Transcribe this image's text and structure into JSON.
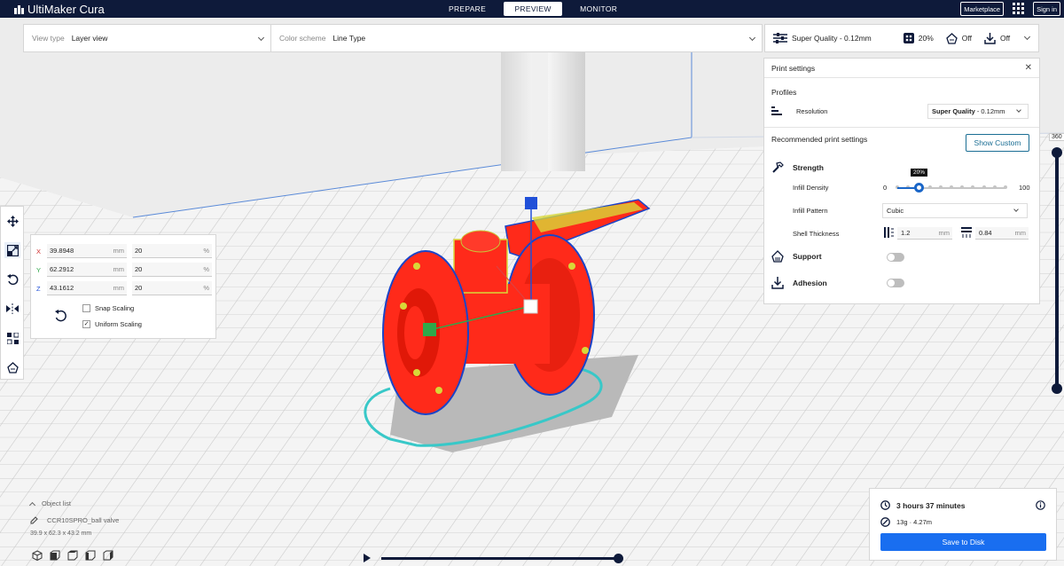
{
  "app": {
    "name": "UltiMaker Cura"
  },
  "stages": [
    {
      "label": "PREPARE",
      "active": false
    },
    {
      "label": "PREVIEW",
      "active": true
    },
    {
      "label": "MONITOR",
      "active": false
    }
  ],
  "topbar": {
    "marketplace_label": "Marketplace",
    "signin_label": "Sign in"
  },
  "view_bar": {
    "view_type_label": "View type",
    "view_type_value": "Layer view",
    "color_scheme_label": "Color scheme",
    "color_scheme_value": "Line Type"
  },
  "quality_bar": {
    "profile": "Super Quality - 0.12mm",
    "infill": "20%",
    "support": "Off",
    "adhesion": "Off"
  },
  "print_settings": {
    "title": "Print settings",
    "profiles_label": "Profiles",
    "resolution_label": "Resolution",
    "resolution_bold": "Super Quality",
    "resolution_rest": " - 0.12mm",
    "recommended_label": "Recommended print settings",
    "show_custom_label": "Show Custom",
    "strength_label": "Strength",
    "infill_density_label": "Infill Density",
    "infill_min": "0",
    "infill_max": "100",
    "infill_value_label": "20%",
    "infill_fraction": 0.2,
    "infill_pattern_label": "Infill Pattern",
    "infill_pattern_value": "Cubic",
    "shell_thickness_label": "Shell Thickness",
    "wall_thickness": "1.2",
    "top_bottom_thickness": "0.84",
    "unit_mm": "mm",
    "support_label": "Support",
    "adhesion_label": "Adhesion"
  },
  "scale_tool": {
    "x_label": "X",
    "x_mm": "39.8948",
    "x_pct": "20",
    "y_label": "Y",
    "y_mm": "62.2912",
    "y_pct": "20",
    "z_label": "Z",
    "z_mm": "43.1612",
    "z_pct": "20",
    "unit_mm": "mm",
    "unit_pct": "%",
    "snap_scaling_label": "Snap Scaling",
    "uniform_scaling_label": "Uniform Scaling",
    "snap_checked": false,
    "uniform_checked": true
  },
  "layer_view": {
    "layer_number": "360"
  },
  "object_list": {
    "header": "Object list",
    "item_name": "CCR10SPRO_ball valve",
    "dimensions": "39.9 x 62.3 x 43.2 mm"
  },
  "print_job": {
    "time": "3 hours 37 minutes",
    "material": "13g · 4.27m",
    "save_label": "Save to Disk"
  },
  "colors": {
    "topbar": "#0e1a3a",
    "accent": "#196ef0",
    "model_fill": "#ff2a1a",
    "shell_outline": "#1a44c8",
    "skirt": "#38c8c8",
    "infill_yellow": "#d8d838"
  }
}
